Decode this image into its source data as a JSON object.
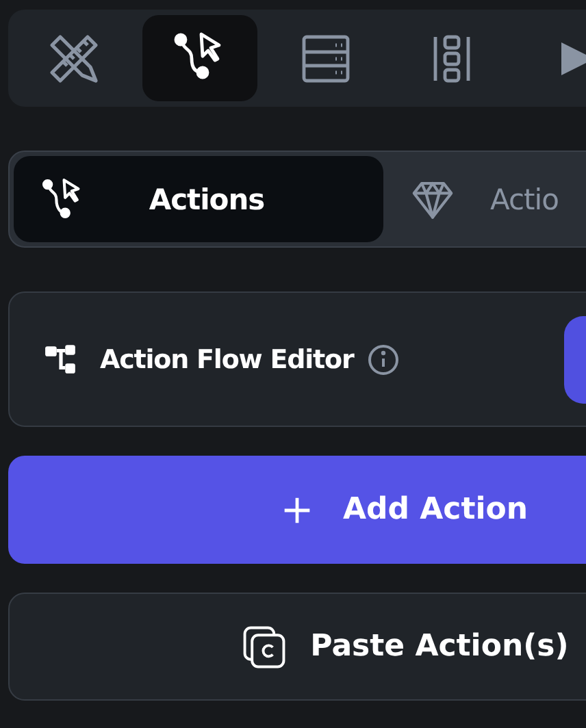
{
  "toolbar": {
    "tabs": [
      {
        "kind": "ruler-pencil",
        "selected": false
      },
      {
        "kind": "flow",
        "selected": true
      },
      {
        "kind": "server",
        "selected": false
      },
      {
        "kind": "columns",
        "selected": false
      },
      {
        "kind": "play",
        "selected": false
      }
    ]
  },
  "segmented": {
    "tabs": [
      {
        "kind": "flow",
        "label": "Actions",
        "selected": true
      },
      {
        "kind": "diamond",
        "label": "Actio",
        "selected": false
      }
    ]
  },
  "flow_editor": {
    "label": "Action Flow Editor"
  },
  "add_button": {
    "label": "Add Action"
  },
  "paste_button": {
    "label": "Paste Action(s)"
  }
}
